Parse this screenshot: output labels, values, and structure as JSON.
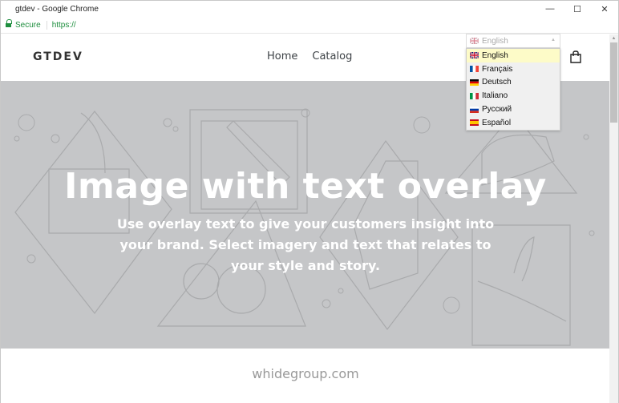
{
  "browser": {
    "window_title": "gtdev - Google Chrome",
    "controls": {
      "minimize": "—",
      "maximize": "☐",
      "close": "✕"
    },
    "security_label": "Secure",
    "url": "https://"
  },
  "header": {
    "logo": "GTDEV",
    "nav": [
      {
        "label": "Home"
      },
      {
        "label": "Catalog"
      }
    ]
  },
  "language_selector": {
    "selected": "English",
    "options": [
      {
        "label": "English",
        "flag": "uk",
        "colors": [
          "#012169",
          "#c8102e",
          "#ffffff"
        ]
      },
      {
        "label": "Français",
        "flag": "fr",
        "colors": [
          "#0055a4",
          "#ffffff",
          "#ef4135"
        ]
      },
      {
        "label": "Deutsch",
        "flag": "de",
        "colors": [
          "#000000",
          "#dd0000",
          "#ffce00"
        ]
      },
      {
        "label": "Italiano",
        "flag": "it",
        "colors": [
          "#009246",
          "#ffffff",
          "#ce2b37"
        ]
      },
      {
        "label": "Русский",
        "flag": "ru",
        "colors": [
          "#ffffff",
          "#0039a6",
          "#d52b1e"
        ]
      },
      {
        "label": "Español",
        "flag": "es",
        "colors": [
          "#c60b1e",
          "#ffc400",
          "#c60b1e"
        ]
      }
    ],
    "highlighted_index": 0
  },
  "hero": {
    "title": "Image with text overlay",
    "text": "Use overlay text to give your customers insight into your brand. Select imagery and text that relates to your style and story.",
    "background_color": "#c5c6c8"
  },
  "footer": {
    "text": "whidegroup.com"
  }
}
